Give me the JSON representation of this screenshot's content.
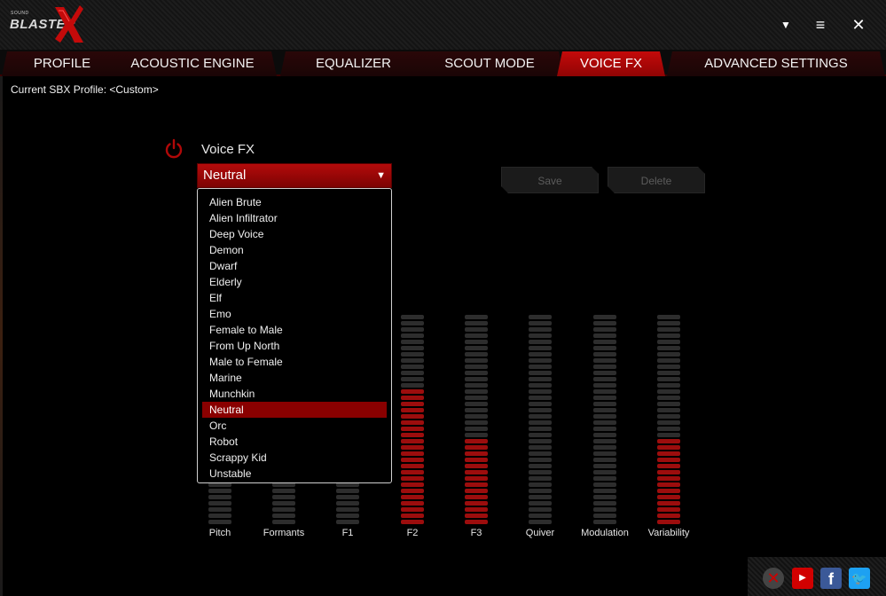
{
  "app": {
    "logo_small": "SOUND",
    "logo_text": "BLASTER",
    "brand_red": "#c40a0a"
  },
  "window_controls": {
    "minimize": "▼",
    "maximize": "≡",
    "close": "✕"
  },
  "tabs": [
    {
      "label": "PROFILE",
      "active": false
    },
    {
      "label": "ACOUSTIC ENGINE",
      "active": false
    },
    {
      "label": "EQUALIZER",
      "active": false
    },
    {
      "label": "SCOUT MODE",
      "active": false
    },
    {
      "label": "VOICE FX",
      "active": true
    },
    {
      "label": "ADVANCED SETTINGS",
      "active": false
    }
  ],
  "profile": {
    "text": "Current SBX Profile: <Custom>"
  },
  "voice_fx": {
    "title": "Voice FX",
    "power_icon": "power-icon",
    "selected": "Neutral",
    "caret": "▼",
    "save_label": "Save",
    "delete_label": "Delete",
    "options": [
      "Alien Brute",
      "Alien Infiltrator",
      "Deep Voice",
      "Demon",
      "Dwarf",
      "Elderly",
      "Elf",
      "Emo",
      "Female to Male",
      "From Up North",
      "Male to Female",
      "Marine",
      "Munchkin",
      "Neutral",
      "Orc",
      "Robot",
      "Scrappy Kid",
      "Unstable"
    ]
  },
  "sliders": [
    {
      "label": "Pitch",
      "level": 0.0
    },
    {
      "label": "Formants",
      "level": 0.0
    },
    {
      "label": "F1",
      "level": 0.0
    },
    {
      "label": "F2",
      "level": 0.65
    },
    {
      "label": "F3",
      "level": 0.41
    },
    {
      "label": "Quiver",
      "level": 0.0
    },
    {
      "label": "Modulation",
      "level": 0.0
    },
    {
      "label": "Variability",
      "level": 0.41
    }
  ],
  "social": {
    "x_icon": "✕",
    "youtube_icon": "▶",
    "facebook_icon": "f",
    "twitter_icon": "🐦"
  }
}
